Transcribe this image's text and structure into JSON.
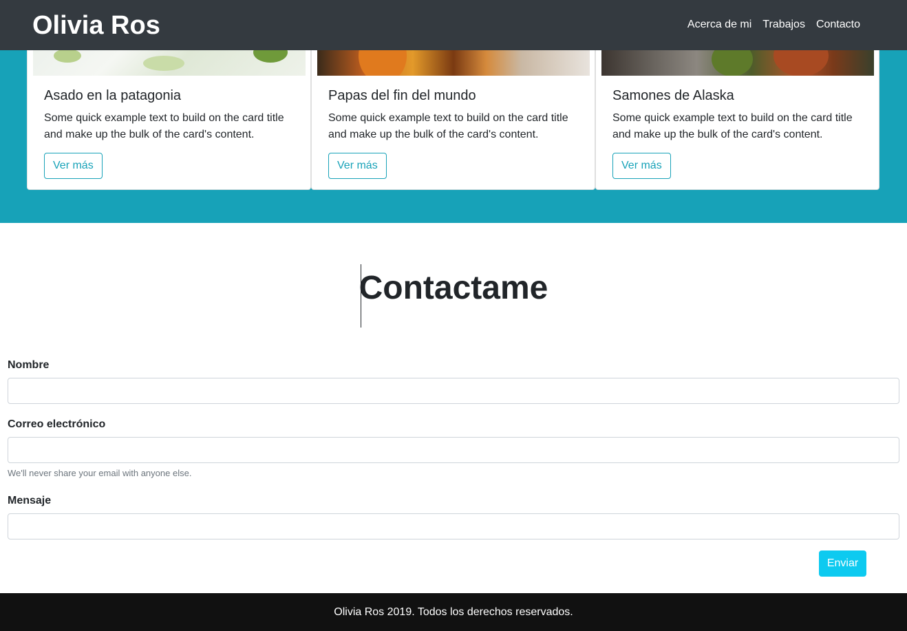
{
  "navbar": {
    "brand": "Olivia Ros",
    "links": [
      "Acerca de mi",
      "Trabajos",
      "Contacto"
    ]
  },
  "works": {
    "cards": [
      {
        "title": "Asado en la patagonia",
        "text": "Some quick example text to build on the card title and make up the bulk of the card's content.",
        "button": "Ver más"
      },
      {
        "title": "Papas del fin del mundo",
        "text": "Some quick example text to build on the card title and make up the bulk of the card's content.",
        "button": "Ver más"
      },
      {
        "title": "Samones de Alaska",
        "text": "Some quick example text to build on the card title and make up the bulk of the card's content.",
        "button": "Ver más"
      }
    ]
  },
  "contact": {
    "title": "Contactame",
    "fields": {
      "name_label": "Nombre",
      "name_value": "",
      "email_label": "Correo electrónico",
      "email_value": "",
      "email_help": "We'll never share your email with anyone else.",
      "message_label": "Mensaje",
      "message_value": ""
    },
    "submit_label": "Enviar"
  },
  "footer": {
    "text": "Olivia Ros 2019. Todos los derechos reservados."
  },
  "colors": {
    "navbar_bg": "#343a40",
    "section_bg": "#17a2b8",
    "accent": "#17a2b8",
    "submit_bg": "#0dcaf0",
    "footer_bg": "#111111"
  }
}
